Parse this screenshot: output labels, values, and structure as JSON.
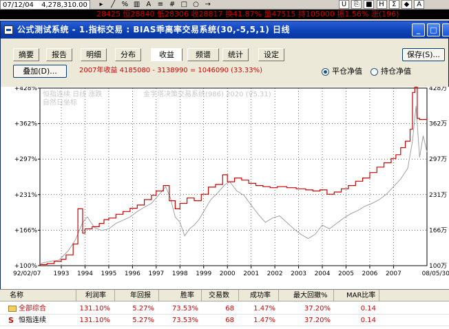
{
  "toolbar": {
    "date": "07/12/04",
    "price": "4,278,310.00",
    "ticker_text": "28425 恒28840 低28306 收28817 换41.87% 量47515 持105000 振1.56% 涨(196)"
  },
  "window": {
    "title": "公式测试系统 - 1.指标交易 : BIAS乖离率交易系统(30,-5,5,1) 日线",
    "min_label": "_",
    "max_label": "□",
    "close_label": "×"
  },
  "tabs": [
    {
      "label": "摘要"
    },
    {
      "label": "报告"
    },
    {
      "label": "明细"
    },
    {
      "label": "分布"
    },
    {
      "label": "收益"
    },
    {
      "label": "频谱"
    },
    {
      "label": "统计"
    },
    {
      "label": "设定"
    }
  ],
  "active_tab": "收益",
  "save_button": "保存(S)...",
  "overlay_button": "叠加(D)...",
  "year_info": "2007年收益 4185080 - 3138990 = 1046090 (33.33%)",
  "radios": {
    "close_net": "平仓净值",
    "hold_net": "持仓净值",
    "selected": "close_net"
  },
  "chart_labels": {
    "legend_line1": "恒指连续 日线 涨跌",
    "legend_line2": "自然日坐标",
    "watermark": "金字塔决策交易系统(986) 2020 (V5.31)"
  },
  "chart_data": {
    "type": "line",
    "colors": {
      "equity": "#cc0000",
      "index": "#a0a0a0"
    },
    "start_label": "92/02/07",
    "end_label": "08/05/30",
    "left_axis": [
      "+428%",
      "+362%",
      "+297%",
      "+231%",
      "+166%",
      "+100%"
    ],
    "right_axis": [
      "428万",
      "362万",
      "297万",
      "231万",
      "166万",
      "100万"
    ],
    "ylim": [
      100,
      428
    ],
    "xlim": [
      1992.1,
      2008.41
    ],
    "year_ticks": [
      "1993",
      "1994",
      "1995",
      "1996",
      "1997",
      "1998",
      "1999",
      "2000",
      "2001",
      "2002",
      "2003",
      "2004",
      "2005",
      "2006",
      "2007"
    ],
    "year_values": [
      1993,
      1994,
      1995,
      1996,
      1997,
      1998,
      1999,
      2000,
      2001,
      2002,
      2003,
      2004,
      2005,
      2006,
      2007
    ],
    "series": [
      {
        "id": "equity",
        "x": [
          1992.1,
          1992.4,
          1992.7,
          1993.0,
          1993.2,
          1993.5,
          1993.7,
          1993.9,
          1994.0,
          1994.3,
          1994.6,
          1994.8,
          1995.0,
          1995.3,
          1995.6,
          1995.9,
          1996.2,
          1996.5,
          1996.8,
          1997.0,
          1997.3,
          1997.55,
          1997.8,
          1998.0,
          1998.3,
          1998.6,
          1998.9,
          1999.2,
          1999.5,
          1999.8,
          2000.0,
          2000.3,
          2000.6,
          2000.9,
          2001.2,
          2001.5,
          2001.8,
          2002.1,
          2002.5,
          2002.9,
          2003.3,
          2003.6,
          2003.9,
          2004.2,
          2004.5,
          2004.8,
          2005.1,
          2005.4,
          2005.7,
          2006.0,
          2006.3,
          2006.6,
          2006.9,
          2007.1,
          2007.3,
          2007.5,
          2007.7,
          2007.8,
          2007.9,
          2008.0,
          2008.1,
          2008.41
        ],
        "y": [
          102,
          104,
          108,
          112,
          120,
          140,
          205,
          160,
          168,
          172,
          178,
          185,
          188,
          195,
          200,
          206,
          212,
          222,
          230,
          238,
          248,
          220,
          205,
          215,
          225,
          220,
          232,
          245,
          250,
          268,
          255,
          262,
          258,
          252,
          248,
          246,
          244,
          246,
          244,
          242,
          240,
          238,
          240,
          232,
          236,
          242,
          248,
          256,
          262,
          272,
          282,
          290,
          298,
          305,
          318,
          330,
          352,
          420,
          430,
          372,
          370,
          368
        ]
      },
      {
        "id": "index",
        "x": [
          1992.1,
          1992.5,
          1992.9,
          1993.3,
          1993.6,
          1993.9,
          1994.1,
          1994.4,
          1994.7,
          1995.0,
          1995.3,
          1995.6,
          1995.9,
          1996.2,
          1996.5,
          1996.8,
          1997.1,
          1997.4,
          1997.6,
          1997.8,
          1998.0,
          1998.2,
          1998.4,
          1998.6,
          1998.8,
          1999.0,
          1999.3,
          1999.6,
          1999.9,
          2000.1,
          2000.4,
          2000.7,
          2001.0,
          2001.3,
          2001.6,
          2001.9,
          2002.2,
          2002.5,
          2002.8,
          2003.1,
          2003.4,
          2003.7,
          2004.0,
          2004.3,
          2004.6,
          2004.9,
          2005.2,
          2005.5,
          2005.8,
          2006.1,
          2006.4,
          2006.7,
          2007.0,
          2007.3,
          2007.6,
          2007.8,
          2007.95,
          2008.1,
          2008.25,
          2008.41
        ],
        "y": [
          104,
          108,
          110,
          128,
          148,
          180,
          190,
          170,
          165,
          168,
          178,
          184,
          190,
          200,
          208,
          215,
          230,
          246,
          225,
          190,
          180,
          155,
          168,
          175,
          185,
          200,
          222,
          235,
          250,
          255,
          238,
          230,
          212,
          195,
          180,
          188,
          192,
          180,
          168,
          158,
          150,
          158,
          175,
          168,
          178,
          188,
          196,
          202,
          210,
          215,
          222,
          232,
          246,
          260,
          280,
          330,
          395,
          300,
          340,
          310
        ]
      }
    ]
  },
  "table": {
    "headers": [
      "名称",
      "利润率",
      "年回报",
      "胜率",
      "交易数",
      "成功率",
      "最大回撤%",
      "MAR比率"
    ],
    "rows": [
      {
        "name": "全部综合",
        "icon": "folder-icon",
        "cells": [
          "131.10%",
          "5.27%",
          "73.53%",
          "68",
          "1.47%",
          "37.20%",
          "0.14"
        ]
      },
      {
        "name": "恒指连续",
        "icon": "s-icon",
        "cells": [
          "131.10%",
          "5.27%",
          "73.53%",
          "68",
          "1.47%",
          "37.20%",
          "0.14"
        ]
      }
    ]
  }
}
